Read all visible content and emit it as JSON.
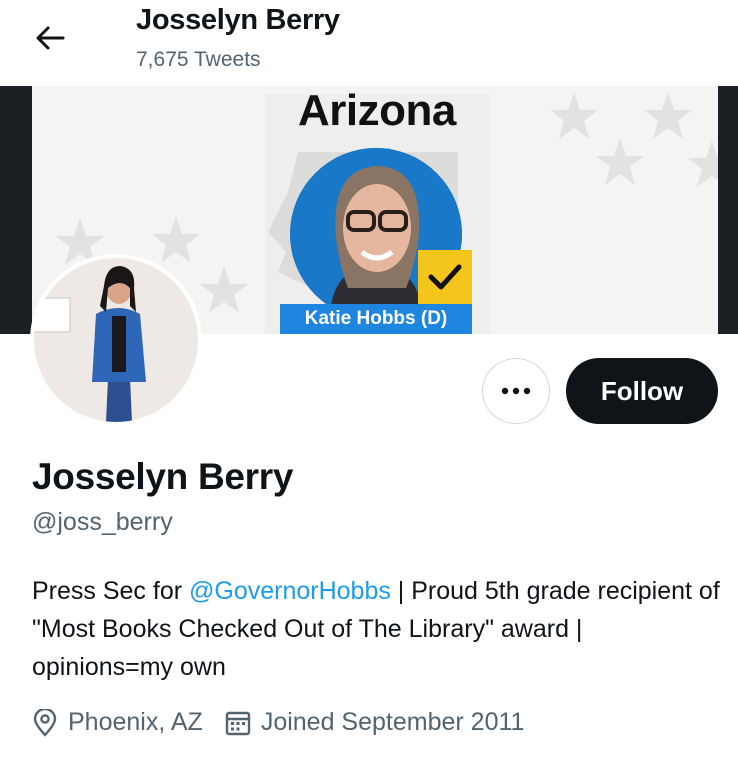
{
  "header": {
    "name": "Josselyn Berry",
    "tweet_count": "7,675 Tweets",
    "back_icon": "arrow-left-icon"
  },
  "banner": {
    "title": "Arizona",
    "name_tag": "Katie Hobbs (D)",
    "colors": {
      "tag_blue": "#1e86e0",
      "check_yellow": "#f4c51a",
      "edge_dark": "#1c1f24"
    }
  },
  "actions": {
    "follow_label": "Follow",
    "more_icon": "more-horizontal-icon"
  },
  "profile": {
    "display_name": "Josselyn Berry",
    "handle": "@joss_berry",
    "bio_prefix": "Press Sec for ",
    "bio_mention": "@GovernorHobbs",
    "bio_suffix": " | Proud 5th grade recipient of \"Most Books Checked Out of The Library\" award | opinions=my own",
    "location": "Phoenix, AZ",
    "joined": "Joined September 2011"
  },
  "colors": {
    "accent": "#1d9bf0",
    "muted": "#536471",
    "text": "#0f1419"
  }
}
